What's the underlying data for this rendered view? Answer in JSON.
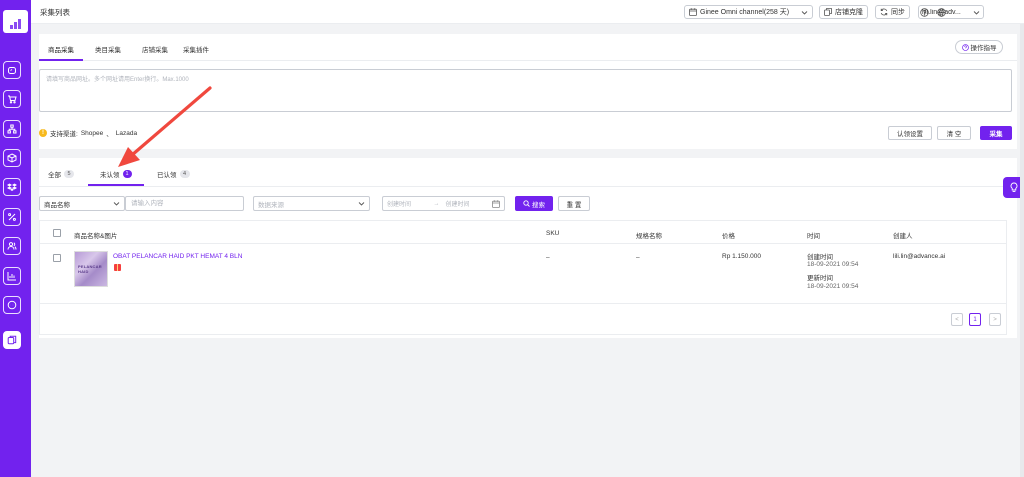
{
  "colors": {
    "brand": "#7222ee",
    "warning": "#f7ba1e",
    "annotation": "#f0483e"
  },
  "sidebar": {
    "items": [
      {
        "icon": "dashboard-icon"
      },
      {
        "icon": "cart-icon"
      },
      {
        "icon": "org-tree-icon"
      },
      {
        "icon": "box-icon"
      },
      {
        "icon": "dropbox-icon"
      },
      {
        "icon": "percent-icon"
      },
      {
        "icon": "users-icon"
      },
      {
        "icon": "chart-icon"
      },
      {
        "icon": "message-icon"
      },
      {
        "icon": "collect-icon",
        "active": true
      }
    ]
  },
  "header": {
    "title": "采集列表",
    "store": "Ginee Omni channel(258 天)",
    "clone_label": "店铺克隆",
    "sync_label": "同步",
    "user": "lili.lin@adv..."
  },
  "collect": {
    "tabs": [
      "商品采集",
      "类目采集",
      "店铺采集",
      "采集插件"
    ],
    "guide_label": "操作指导",
    "url_placeholder": "请填写商品网址。多个网址请用Enter换行。Max.1000",
    "channels_label": "支持渠道:",
    "channel_1": "Shopee",
    "channel_sep": "、",
    "channel_2": "Lazada",
    "claim_settings_label": "认领设置",
    "clear_label": "清 空",
    "collect_label": "采集"
  },
  "list": {
    "tabs": [
      {
        "label": "全部",
        "count": "5"
      },
      {
        "label": "未认领",
        "count": "1"
      },
      {
        "label": "已认领",
        "count": "4"
      }
    ],
    "filter": {
      "field": "商品名称",
      "keyword_placeholder": "请输入内容",
      "source_placeholder": "数据来源",
      "date_start": "创建时间",
      "date_sep": "→",
      "date_end": "创建时间",
      "search_label": "搜索",
      "reset_label": "重 置"
    },
    "columns": [
      "商品名称&图片",
      "SKU",
      "规格名称",
      "价格",
      "时间",
      "创建人"
    ],
    "rows": [
      {
        "thumb_text": "PELANCAR HAID",
        "name": "OBAT PELANCAR HAID PKT HEMAT 4 BLN",
        "sku": "–",
        "spec": "–",
        "price": "Rp 1.150.000",
        "created_label": "创建时间",
        "created_at": "18-09-2021 09:54",
        "updated_label": "更新时间",
        "updated_at": "18-09-2021 09:54",
        "creator": "lili.lin@advance.ai"
      }
    ],
    "pager": {
      "prev": "<",
      "current": "1",
      "next": ">"
    }
  }
}
